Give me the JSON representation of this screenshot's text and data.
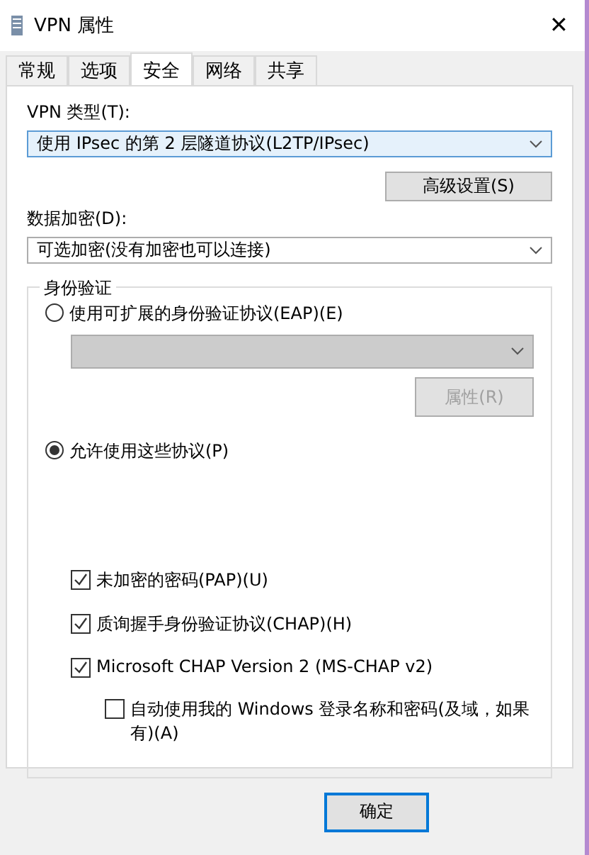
{
  "window": {
    "title": "VPN 属性",
    "close": "✕"
  },
  "tabs": [
    {
      "label": "常规",
      "selected": false
    },
    {
      "label": "选项",
      "selected": false
    },
    {
      "label": "安全",
      "selected": true
    },
    {
      "label": "网络",
      "selected": false
    },
    {
      "label": "共享",
      "selected": false
    }
  ],
  "vpn_type": {
    "label": "VPN 类型(T):",
    "value": "使用 IPsec 的第 2 层隧道协议(L2TP/IPsec)"
  },
  "advanced_button": "高级设置(S)",
  "encryption": {
    "label": "数据加密(D):",
    "value": "可选加密(没有加密也可以连接)"
  },
  "auth": {
    "title": "身份验证",
    "options": [
      {
        "label": "使用可扩展的身份验证协议(EAP)(E)",
        "selected": false
      },
      {
        "label": "允许使用这些协议(P)",
        "selected": true
      }
    ],
    "eap_dropdown": {
      "disabled": true
    },
    "properties_button": {
      "label": "属性(R)",
      "disabled": true
    },
    "protocols": [
      {
        "label": "未加密的密码(PAP)(U)",
        "checked": true,
        "nested": false
      },
      {
        "label": "质询握手身份验证协议(CHAP)(H)",
        "checked": true,
        "nested": false
      },
      {
        "label": "Microsoft CHAP Version 2 (MS-CHAP v2)",
        "checked": true,
        "nested": false
      },
      {
        "label": "自动使用我的 Windows 登录名称和密码(及域，如果有)(A)",
        "checked": false,
        "nested": true
      }
    ]
  },
  "buttons": [
    "确定"
  ]
}
